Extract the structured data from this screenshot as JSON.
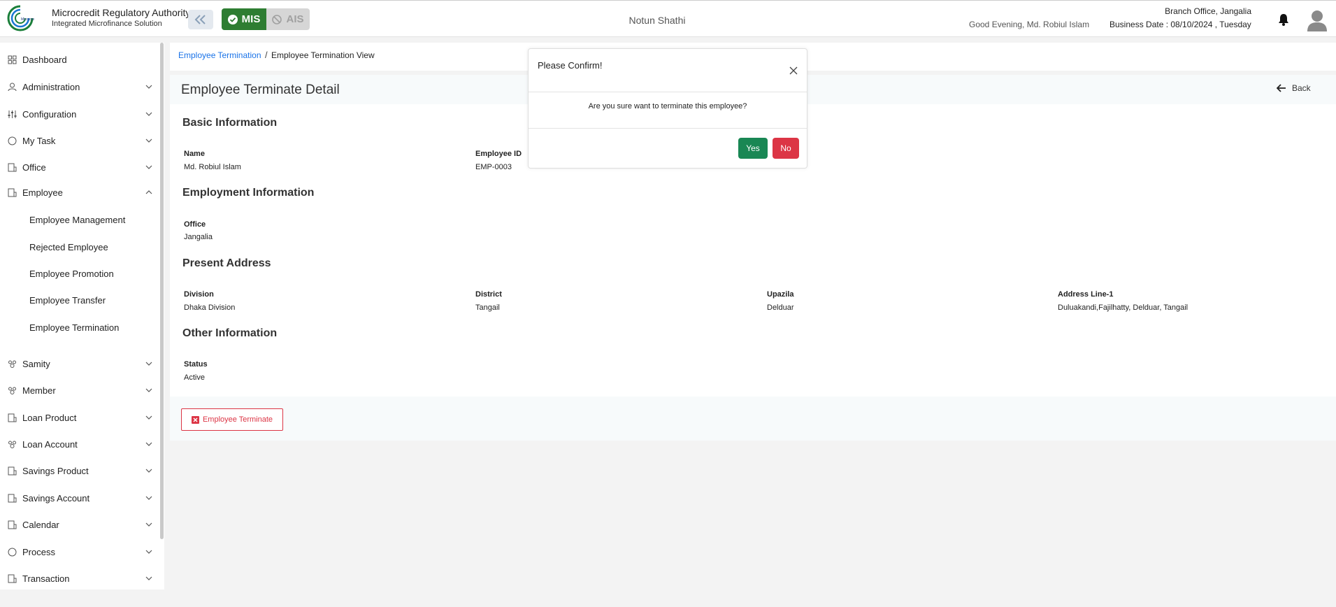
{
  "header": {
    "org_name": "Microcredit Regulatory Authority",
    "org_sub": "Integrated Microfinance Solution",
    "mode_mis": "MIS",
    "mode_ais": "AIS",
    "center_title": "Notun Shathi",
    "greeting": "Good Evening, Md. Robiul Islam",
    "branch": "Branch Office, Jangalia",
    "business_date": "Business Date : 08/10/2024 , Tuesday"
  },
  "sidebar": {
    "items": [
      {
        "label": "Dashboard",
        "icon": "dashboard-icon"
      },
      {
        "label": "Administration",
        "icon": "admin-icon"
      },
      {
        "label": "Configuration",
        "icon": "config-icon"
      },
      {
        "label": "My Task",
        "icon": "task-icon"
      },
      {
        "label": "Office",
        "icon": "office-icon"
      },
      {
        "label": "Employee",
        "icon": "employee-icon"
      },
      {
        "label": "Samity",
        "icon": "samity-icon"
      },
      {
        "label": "Member",
        "icon": "member-icon"
      },
      {
        "label": "Loan Product",
        "icon": "loan-product-icon"
      },
      {
        "label": "Loan Account",
        "icon": "loan-account-icon"
      },
      {
        "label": "Savings Product",
        "icon": "savings-product-icon"
      },
      {
        "label": "Savings Account",
        "icon": "savings-account-icon"
      },
      {
        "label": "Calendar",
        "icon": "calendar-icon"
      },
      {
        "label": "Process",
        "icon": "process-icon"
      },
      {
        "label": "Transaction",
        "icon": "transaction-icon"
      }
    ],
    "employee_sub": [
      "Employee Management",
      "Rejected Employee",
      "Employee Promotion",
      "Employee Transfer",
      "Employee Termination"
    ]
  },
  "breadcrumb": {
    "link": "Employee Termination",
    "separator": "/",
    "current": "Employee Termination View"
  },
  "detail": {
    "title": "Employee Terminate Detail",
    "back_label": "Back",
    "sections": {
      "basic": "Basic Information",
      "employment": "Employment Information",
      "present_address": "Present Address",
      "other": "Other Information"
    },
    "fields": {
      "name_label": "Name",
      "name_value": "Md. Robiul Islam",
      "empid_label": "Employee ID",
      "empid_value": "EMP-0003",
      "office_label": "Office",
      "office_value": "Jangalia",
      "division_label": "Division",
      "division_value": "Dhaka Division",
      "district_label": "District",
      "district_value": "Tangail",
      "upazila_label": "Upazila",
      "upazila_value": "Delduar",
      "address_label": "Address Line-1",
      "address_value": "Duluakandi,Fajilhatty, Delduar, Tangail",
      "status_label": "Status",
      "status_value": "Active"
    },
    "terminate_button": "Employee Terminate"
  },
  "modal": {
    "title": "Please Confirm!",
    "message": "Are you sure want to terminate this employee?",
    "yes": "Yes",
    "no": "No"
  },
  "colors": {
    "primary_link": "#1a73e8",
    "success": "#198754",
    "danger": "#dc3545",
    "mis_green": "#2e7d32"
  }
}
